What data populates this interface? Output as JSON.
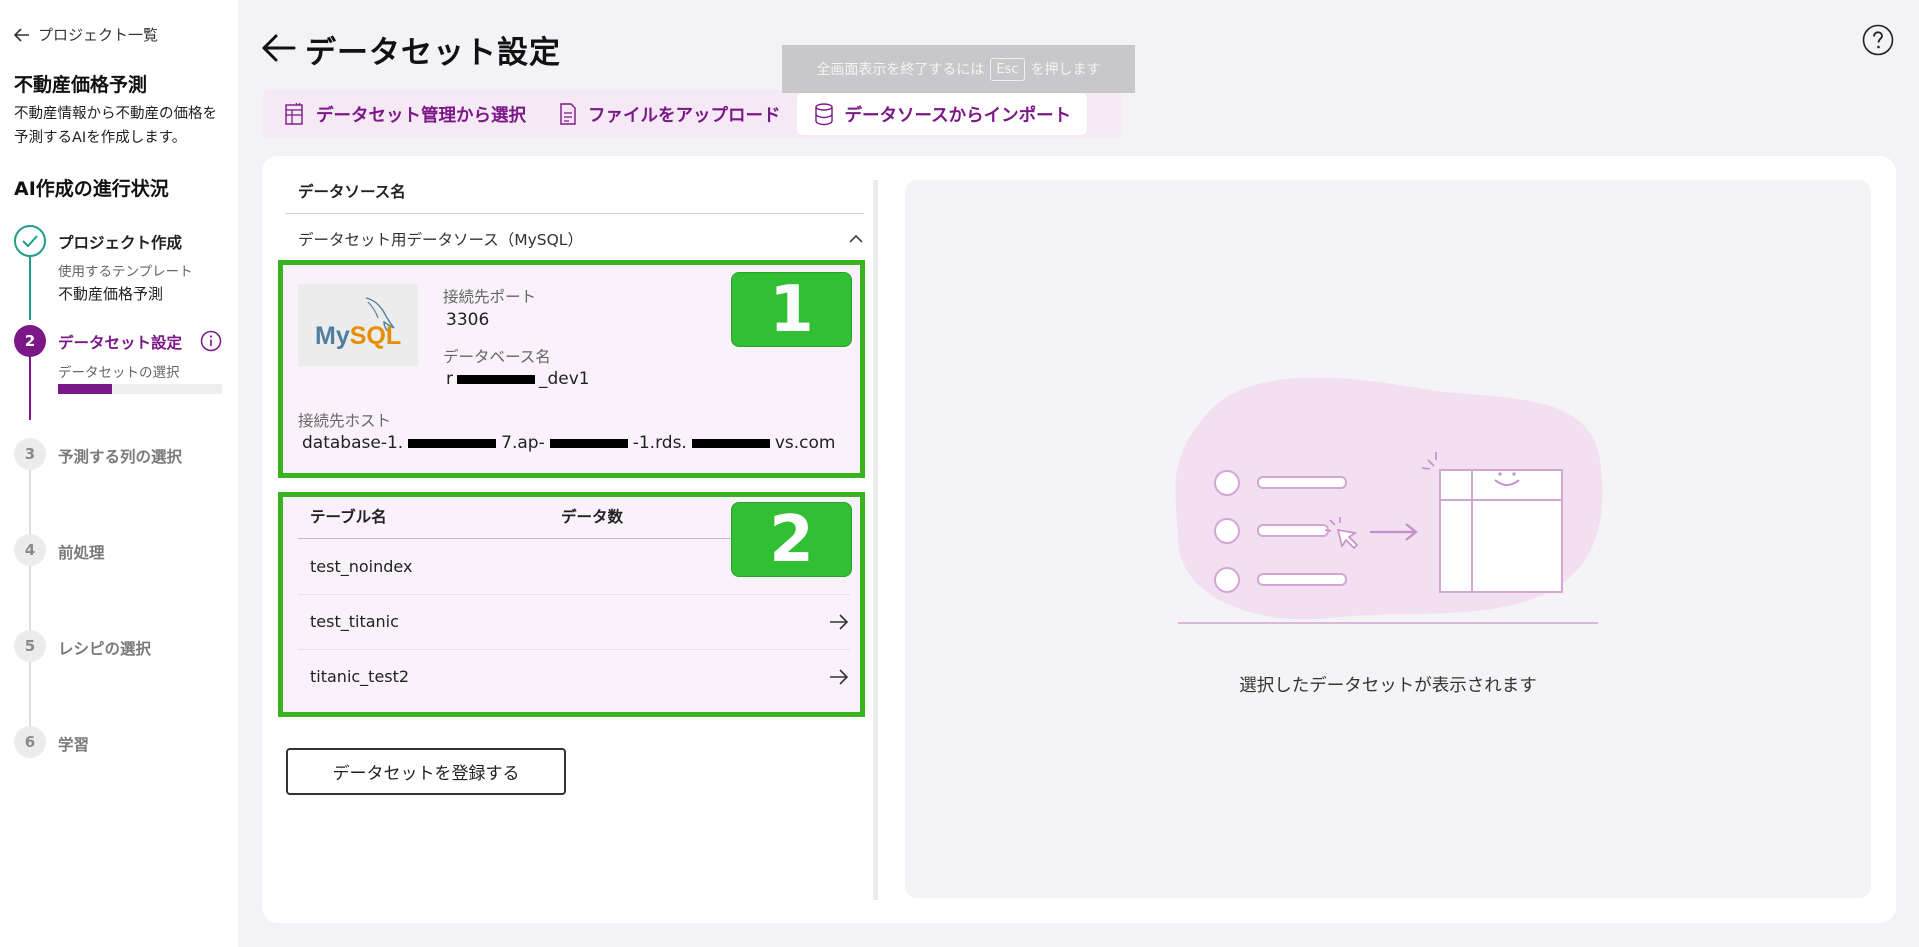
{
  "sidebar": {
    "back_label": "プロジェクト一覧",
    "project_name": "不動産価格予測",
    "project_desc": "不動産情報から不動産の価格を予測するAIを作成します。",
    "progress_title": "AI作成の進行状況",
    "steps": [
      {
        "number": "",
        "title": "プロジェクト作成",
        "sub": "使用するテンプレート",
        "value": "不動産価格予測",
        "state": "done"
      },
      {
        "number": "2",
        "title": "データセット設定",
        "sub": "データセットの選択",
        "progress": 0.33,
        "state": "active"
      },
      {
        "number": "3",
        "title": "予測する列の選択",
        "state": "todo"
      },
      {
        "number": "4",
        "title": "前処理",
        "state": "todo"
      },
      {
        "number": "5",
        "title": "レシピの選択",
        "state": "todo"
      },
      {
        "number": "6",
        "title": "学習",
        "state": "todo"
      }
    ]
  },
  "page": {
    "title": "データセット設定"
  },
  "esc_banner": {
    "before": "全画面表示を終了するには",
    "key": "Esc",
    "after": "を押します"
  },
  "tabs": [
    {
      "label": "データセット管理から選択",
      "icon": "dataset-icon"
    },
    {
      "label": "ファイルをアップロード",
      "icon": "file-icon"
    },
    {
      "label": "データソースからインポート",
      "icon": "database-icon",
      "selected": true
    }
  ],
  "datasource": {
    "column_header": "データソース名",
    "name": "データセット用データソース（MySQL）",
    "port_label": "接続先ポート",
    "port": "3306",
    "db_label": "データベース名",
    "db_prefix": "r",
    "db_suffix": "_dev1",
    "host_label": "接続先ホスト",
    "host_part1": "database-1.",
    "host_part2": "7.ap-",
    "host_part3": "-1.rds.",
    "host_part4": "vs.com",
    "logo_text": "MySQL"
  },
  "badges": [
    "1",
    "2"
  ],
  "tables": {
    "headers": [
      "テーブル名",
      "データ数"
    ],
    "rows": [
      {
        "name": "test_noindex"
      },
      {
        "name": "test_titanic"
      },
      {
        "name": "titanic_test2"
      }
    ]
  },
  "register_button": "データセットを登録する",
  "preview": {
    "placeholder": "選択したデータセットが表示されます"
  },
  "colors": {
    "accent": "#7b1787",
    "done": "#1f9c8a",
    "highlight_border": "#39b31f",
    "badge": "#31c034"
  }
}
